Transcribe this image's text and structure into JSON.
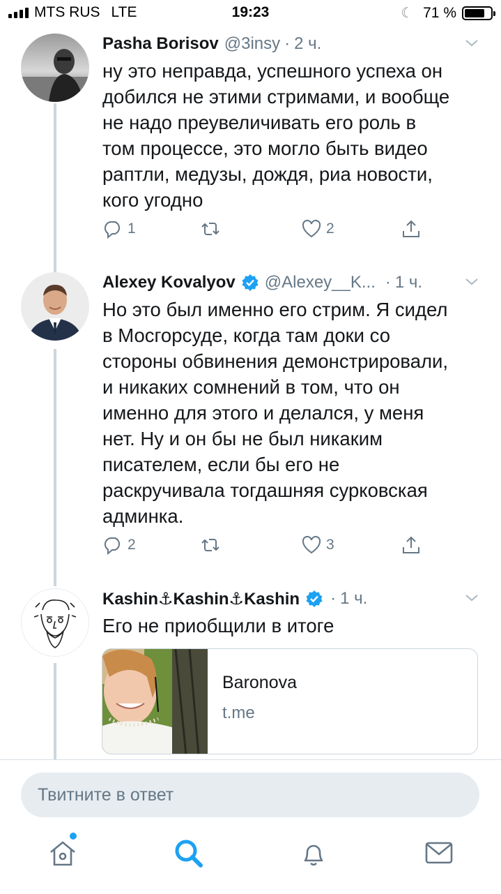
{
  "status_bar": {
    "carrier": "MTS RUS",
    "network": "LTE",
    "time": "19:23",
    "battery": "71 %",
    "battery_level": 0.71
  },
  "tweets": [
    {
      "name": "Pasha Borisov",
      "handle": "@3insy",
      "dot": "·",
      "time": "2 ч.",
      "text": "ну это неправда, успешного успеха он\nдобился не этими стримами, и вообще\nне надо преувеличивать его роль в\nтом процессе, это могло быть видео\nраптли, медузы, дождя, риа новости,\nкого угодно",
      "replies": "1",
      "retweets": "",
      "likes": "2"
    },
    {
      "name": "Alexey Kovalyov",
      "handle": "@Alexey__K...",
      "dot": "·",
      "time": "1 ч.",
      "verified": true,
      "text": "Но это был именно его стрим. Я сидел\nв Мосгорсуде, когда там доки со\nстороны обвинения демонстрировали,\nи никаких сомнений в том, что он\nименно для этого и делался, у меня\nнет. Ну и он бы не был никаким\nписателем, если бы его не\nраскручивала тогдашняя сурковская\nадминка.",
      "replies": "2",
      "retweets": "",
      "likes": "3"
    },
    {
      "name": "Kashin⚓Kashin⚓Kashin",
      "handle": "",
      "dot": "·",
      "time": "1 ч.",
      "verified": true,
      "text": "Его не приобщили в итоге",
      "card": {
        "title": "Baronova",
        "domain": "t.me"
      }
    }
  ],
  "reply": {
    "placeholder": "Твитните в ответ"
  },
  "icons": {
    "reply": "reply-icon",
    "retweet": "retweet-icon",
    "like": "heart-icon",
    "share": "share-icon",
    "verified": "verified-badge-icon",
    "caret": "chevron-down-icon",
    "home": "home-icon",
    "search": "search-icon",
    "notifications": "bell-icon",
    "messages": "envelope-icon"
  },
  "colors": {
    "accent": "#1da1f2",
    "secondary_text": "#657786",
    "thread_line": "#ccd6dd"
  }
}
